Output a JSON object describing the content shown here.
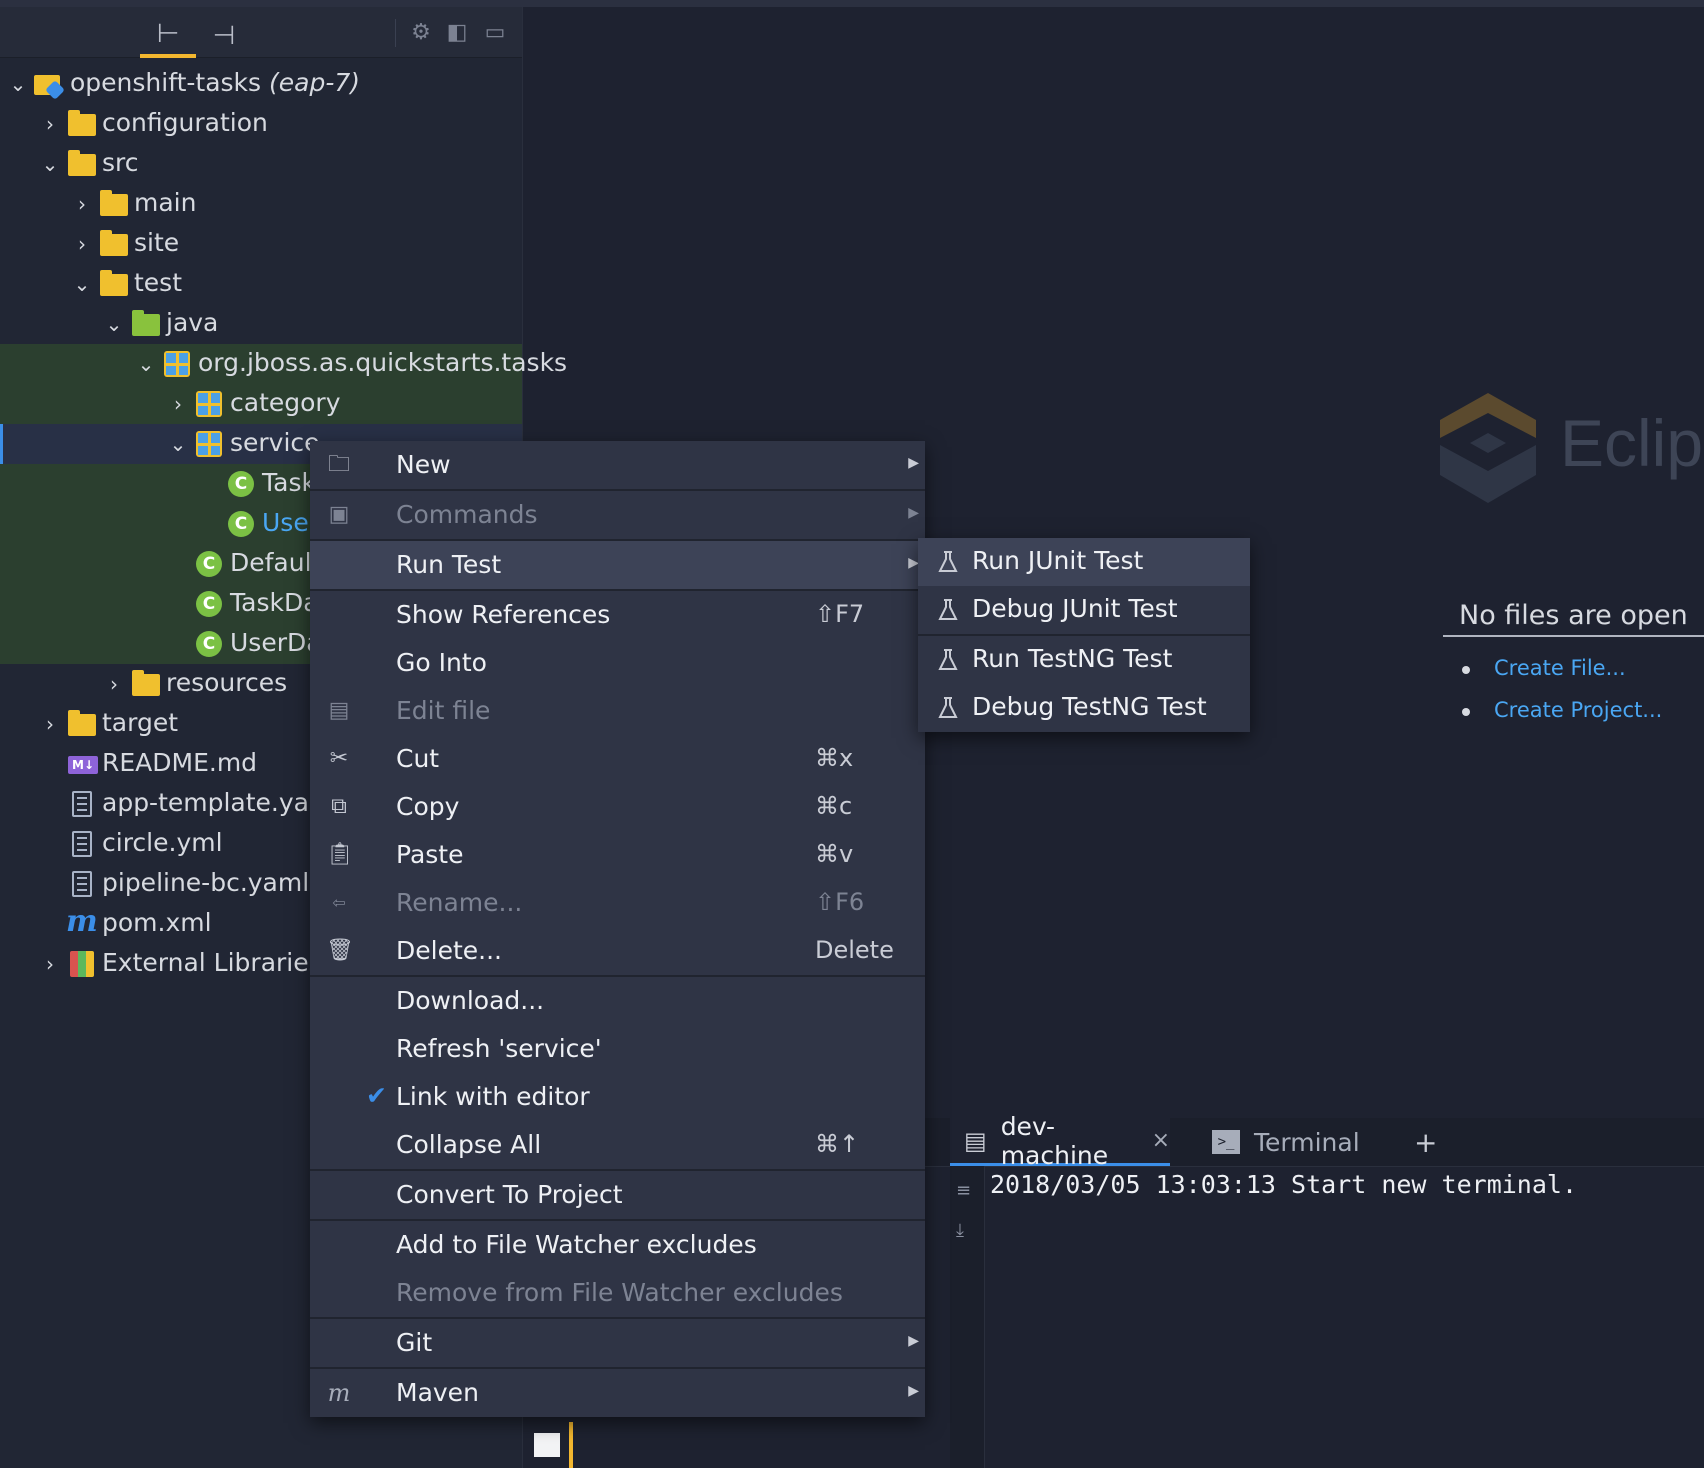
{
  "explorer": {
    "tabs": [
      "project-explorer",
      "structure"
    ],
    "tree": [
      {
        "label": "openshift-tasks",
        "suffix": "(eap-7)"
      },
      {
        "label": "configuration"
      },
      {
        "label": "src"
      },
      {
        "label": "main"
      },
      {
        "label": "site"
      },
      {
        "label": "test"
      },
      {
        "label": "java"
      },
      {
        "label": "org.jboss.as.quickstarts.tasks"
      },
      {
        "label": "category"
      },
      {
        "label": "service"
      },
      {
        "label": "Task"
      },
      {
        "label": "User"
      },
      {
        "label": "Default"
      },
      {
        "label": "TaskDa"
      },
      {
        "label": "UserDa"
      },
      {
        "label": "resources"
      },
      {
        "label": "target"
      },
      {
        "label": "README.md",
        "badge": "M↓"
      },
      {
        "label": "app-template.yaml"
      },
      {
        "label": "circle.yml"
      },
      {
        "label": "pipeline-bc.yaml"
      },
      {
        "label": "pom.xml",
        "badge": "m"
      },
      {
        "label": "External Libraries"
      }
    ]
  },
  "context_menu": {
    "items": [
      {
        "label": "New"
      },
      {
        "label": "Commands"
      },
      {
        "label": "Run Test"
      },
      {
        "label": "Show References",
        "shortcut": "⇧F7"
      },
      {
        "label": "Go Into"
      },
      {
        "label": "Edit file"
      },
      {
        "label": "Cut",
        "shortcut": "⌘x"
      },
      {
        "label": "Copy",
        "shortcut": "⌘c"
      },
      {
        "label": "Paste",
        "shortcut": "⌘v"
      },
      {
        "label": "Rename...",
        "shortcut": "⇧F6"
      },
      {
        "label": "Delete...",
        "shortcut": "Delete"
      },
      {
        "label": "Download..."
      },
      {
        "label": "Refresh 'service'"
      },
      {
        "label": "Link with editor"
      },
      {
        "label": "Collapse All",
        "shortcut": "⌘↑"
      },
      {
        "label": "Convert To Project"
      },
      {
        "label": "Add to File Watcher excludes"
      },
      {
        "label": "Remove from File Watcher excludes"
      },
      {
        "label": "Git"
      },
      {
        "label": "Maven",
        "icon_text": "m"
      }
    ]
  },
  "run_test_submenu": {
    "items": [
      {
        "label": "Run JUnit Test"
      },
      {
        "label": "Debug JUnit Test"
      },
      {
        "label": "Run TestNG Test"
      },
      {
        "label": "Debug TestNG Test"
      }
    ]
  },
  "editor": {
    "logo_text": "Eclipse",
    "empty_title": "No files are open",
    "links": [
      "Create File...",
      "Create Project..."
    ]
  },
  "terminal": {
    "tabs": [
      {
        "label": "dev-machine",
        "close": "×"
      },
      {
        "label": "Terminal"
      }
    ],
    "add_label": "+",
    "output": "2018/03/05 13:03:13 Start new terminal."
  },
  "colors": {
    "accent": "#3b8ee8",
    "tab_indicator": "#f3b72f",
    "folder": "#f0c02e",
    "package_highlight": "#2b3f2f",
    "menu_bg": "#2f3445"
  }
}
